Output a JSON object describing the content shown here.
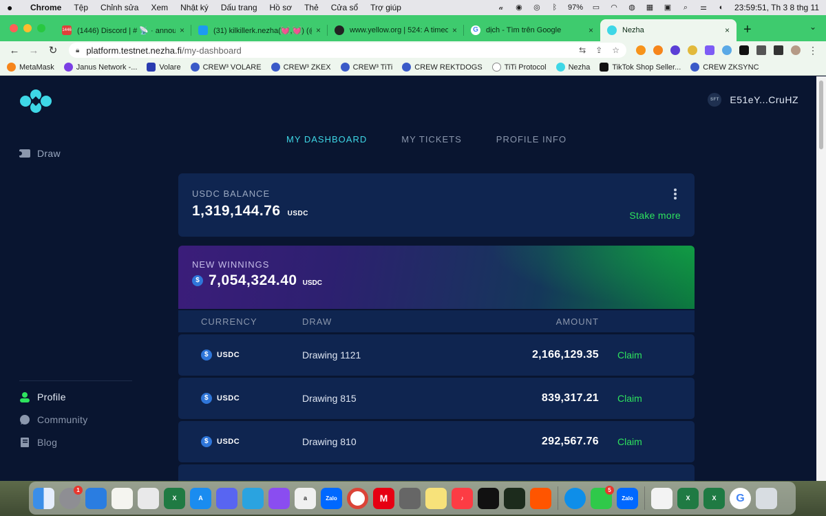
{
  "menubar": {
    "app": "Chrome",
    "items": [
      "Tệp",
      "Chỉnh sửa",
      "Xem",
      "Nhật ký",
      "Dấu trang",
      "Hồ sơ",
      "Thẻ",
      "Cửa sổ",
      "Trợ giúp"
    ],
    "battery": "97%",
    "clock": "23:59:51, Th 3 8 thg 11"
  },
  "tabs": [
    {
      "title": "(1446) Discord | # 📡 · annou",
      "favicon_color": "#e0403a",
      "favicon_text": "1446"
    },
    {
      "title": "(31) kilkillerk.nezha(💓,💓) (@k",
      "favicon_color": "#1d9bf0",
      "favicon_text": ""
    },
    {
      "title": "www.yellow.org | 524: A timeou",
      "favicon_color": "#222222",
      "favicon_text": ""
    },
    {
      "title": "dịch - Tìm trên Google",
      "favicon_color": "#ffffff",
      "favicon_text": "G"
    },
    {
      "title": "Nezha",
      "favicon_color": "#3ed7e6",
      "favicon_text": ""
    }
  ],
  "address": {
    "domain": "platform.testnet.nezha.fi",
    "path": "/my-dashboard"
  },
  "bookmarks": [
    {
      "label": "MetaMask",
      "color": "#f6851b"
    },
    {
      "label": "Janus Network -...",
      "color": "#7b3fe4"
    },
    {
      "label": "Volare",
      "color": "#2a3bb0"
    },
    {
      "label": "CREW³ VOLARE",
      "color": "#3a5ac8"
    },
    {
      "label": "CREW³ ZKEX",
      "color": "#3a5ac8"
    },
    {
      "label": "CREW³ TiTi",
      "color": "#3a5ac8"
    },
    {
      "label": "CREW REKTDOGS",
      "color": "#3a5ac8"
    },
    {
      "label": "TiTi Protocol",
      "color": "#888888"
    },
    {
      "label": "Nezha",
      "color": "#3ed7e6"
    },
    {
      "label": "TikTok Shop Seller...",
      "color": "#111111"
    },
    {
      "label": "CREW ZKSYNC",
      "color": "#3a5ac8"
    }
  ],
  "wallet": {
    "avatar_text": "SFT",
    "address": "E51eY...CruHZ"
  },
  "sidebar": {
    "draw": "Draw",
    "bottom": [
      {
        "label": "Profile",
        "icon": "person-icon"
      },
      {
        "label": "Community",
        "icon": "chat-icon"
      },
      {
        "label": "Blog",
        "icon": "book-icon"
      }
    ]
  },
  "nav": {
    "tabs": [
      "MY DASHBOARD",
      "MY TICKETS",
      "PROFILE INFO"
    ],
    "active": "MY DASHBOARD"
  },
  "balance": {
    "label": "USDC BALANCE",
    "value": "1,319,144.76",
    "unit": "USDC",
    "action": "Stake more"
  },
  "winnings": {
    "label": "NEW WINNINGS",
    "value": "7,054,324.40",
    "unit": "USDC"
  },
  "table": {
    "headers": {
      "currency": "CURRENCY",
      "draw": "DRAW",
      "amount": "AMOUNT"
    },
    "rows": [
      {
        "currency": "USDC",
        "draw": "Drawing 1121",
        "amount": "2,166,129.35",
        "action": "Claim"
      },
      {
        "currency": "USDC",
        "draw": "Drawing 815",
        "amount": "839,317.21",
        "action": "Claim"
      },
      {
        "currency": "USDC",
        "draw": "Drawing 810",
        "amount": "292,567.76",
        "action": "Claim"
      }
    ]
  },
  "colors": {
    "accent": "#3ed7e6",
    "success": "#2ee35e",
    "page_bg": "#091530",
    "card_bg": "#0f2550"
  },
  "dock": {
    "badges": {
      "settings": "1",
      "facetime": "5"
    }
  }
}
